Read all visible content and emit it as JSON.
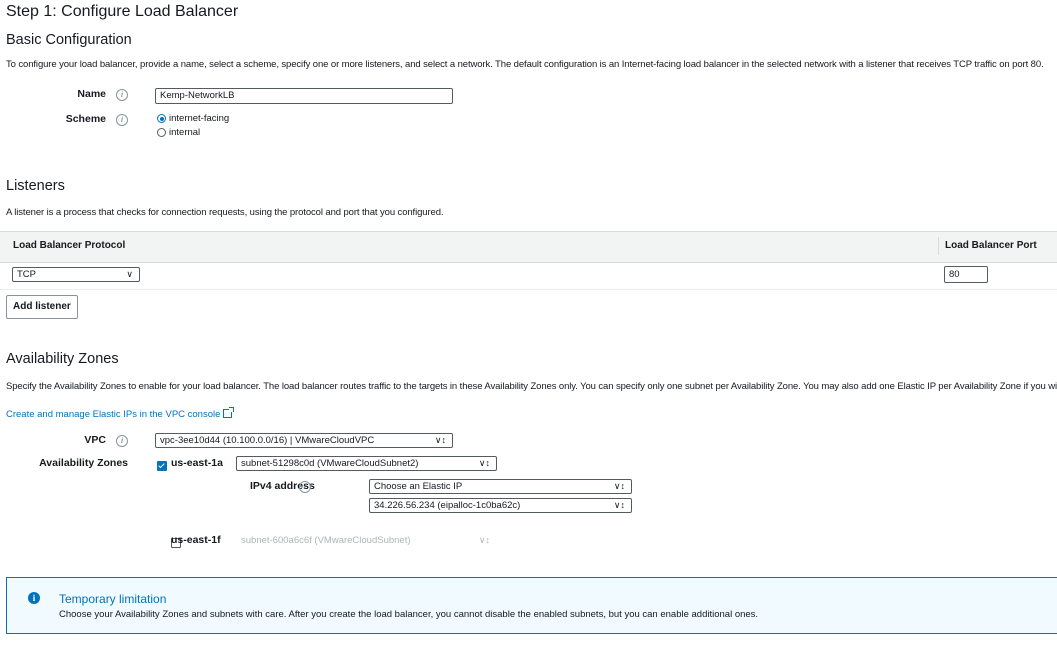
{
  "page": {
    "step_title": "Step 1: Configure Load Balancer"
  },
  "basic": {
    "heading": "Basic Configuration",
    "description": "To configure your load balancer, provide a name, select a scheme, specify one or more listeners, and select a network. The default configuration is an Internet-facing load balancer in the selected network with a listener that receives TCP traffic on port 80.",
    "name_label": "Name",
    "name_value": "Kemp-NetworkLB",
    "scheme_label": "Scheme",
    "scheme_options": [
      "internet-facing",
      "internal"
    ],
    "scheme_selected": "internet-facing"
  },
  "listeners": {
    "heading": "Listeners",
    "description": "A listener is a process that checks for connection requests, using the protocol and port that you configured.",
    "col_protocol": "Load Balancer Protocol",
    "col_port": "Load Balancer Port",
    "rows": [
      {
        "protocol": "TCP",
        "port": "80"
      }
    ],
    "add_button": "Add listener"
  },
  "az": {
    "heading": "Availability Zones",
    "description": "Specify the Availability Zones to enable for your load balancer. The load balancer routes traffic to the targets in these Availability Zones only. You can specify only one subnet per Availability Zone. You may also add one Elastic IP per Availability Zone if you wi",
    "elastic_ip_link": "Create and manage Elastic IPs in the VPC console",
    "vpc_label": "VPC",
    "vpc_value": "vpc-3ee10d44 (10.100.0.0/16) | VMwareCloudVPC",
    "zones_label": "Availability Zones",
    "zones": [
      {
        "name": "us-east-1a",
        "checked": true,
        "subnet": "subnet-51298c0d (VMwareCloudSubnet2)",
        "ipv4_label": "IPv4 address",
        "ipv4_select": "Choose an Elastic IP",
        "ipv4_value": "34.226.56.234 (eipalloc-1c0ba62c)"
      },
      {
        "name": "us-east-1f",
        "checked": false,
        "subnet": "subnet-600a6c6f (VMwareCloudSubnet)"
      }
    ]
  },
  "alert": {
    "title": "Temporary limitation",
    "text": "Choose your Availability Zones and subnets with care. After you create the load balancer, you cannot disable the enabled subnets, but you can enable additional ones."
  },
  "colors": {
    "accent": "#0073bb",
    "table_header_bg": "#f2f3f3",
    "alert_bg": "#f1faff"
  }
}
